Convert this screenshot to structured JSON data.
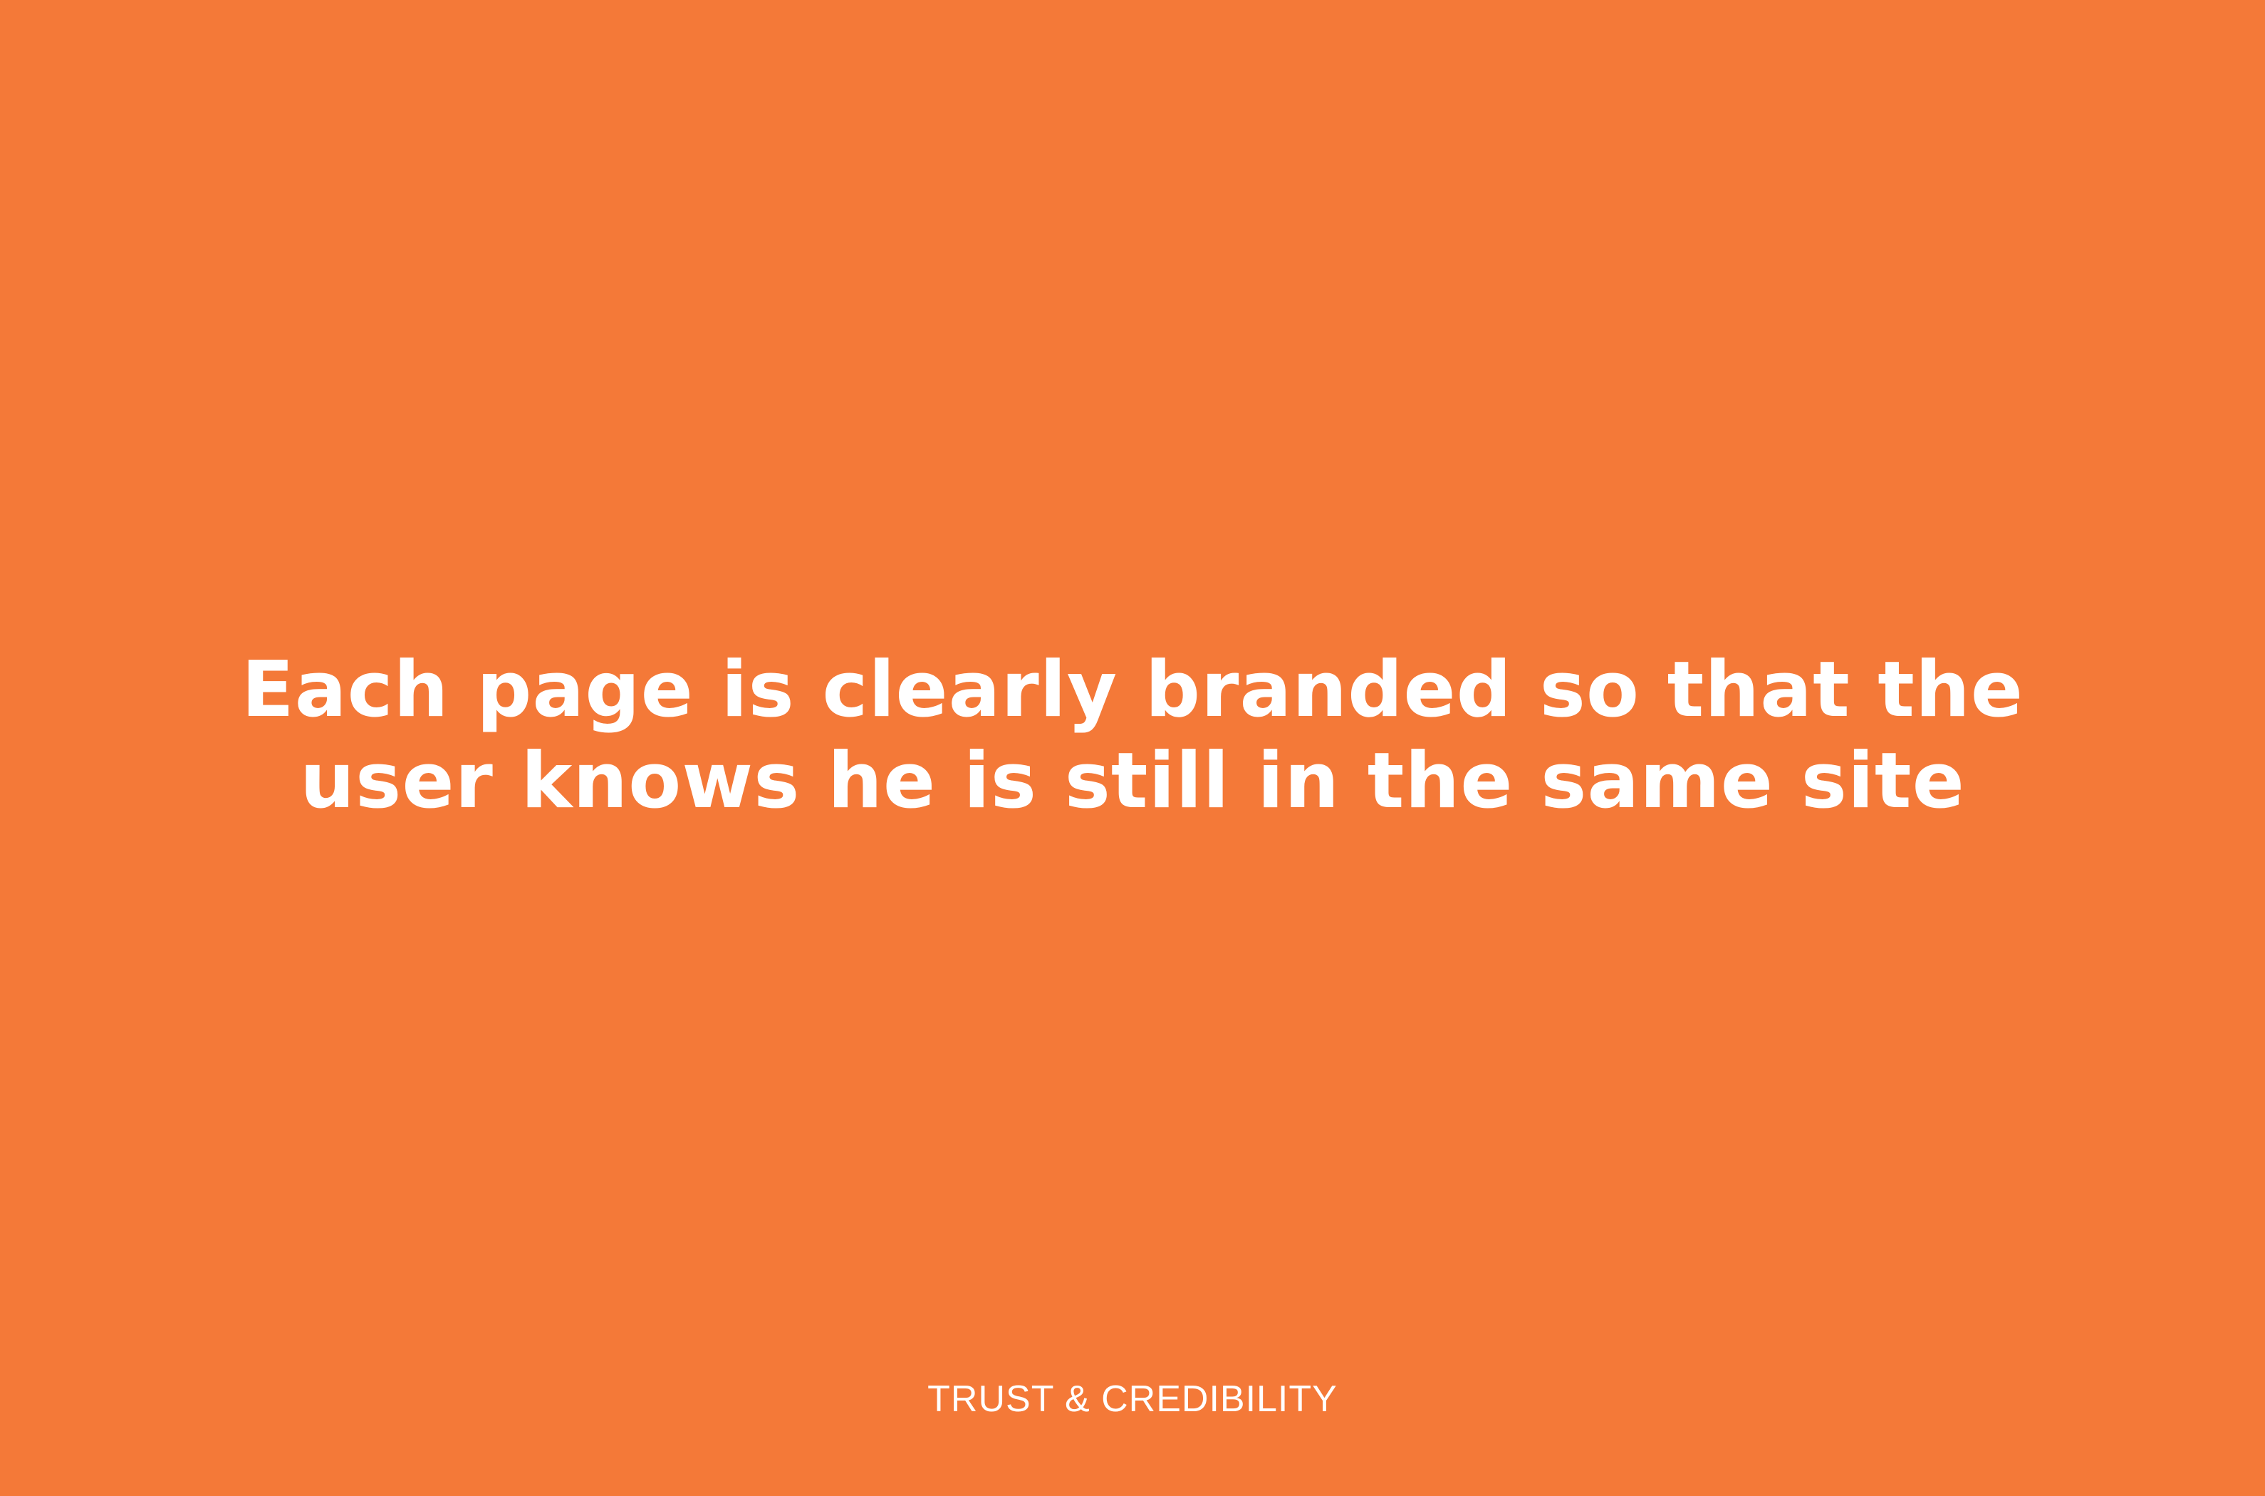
{
  "slide": {
    "headline_lines": [
      "Each page is clearly branded so that the",
      "user knows he is still in the same site"
    ],
    "footer_label": "TRUST & CREDIBILITY"
  },
  "colors": {
    "background": "#F47938",
    "text": "#FFFFFF"
  }
}
